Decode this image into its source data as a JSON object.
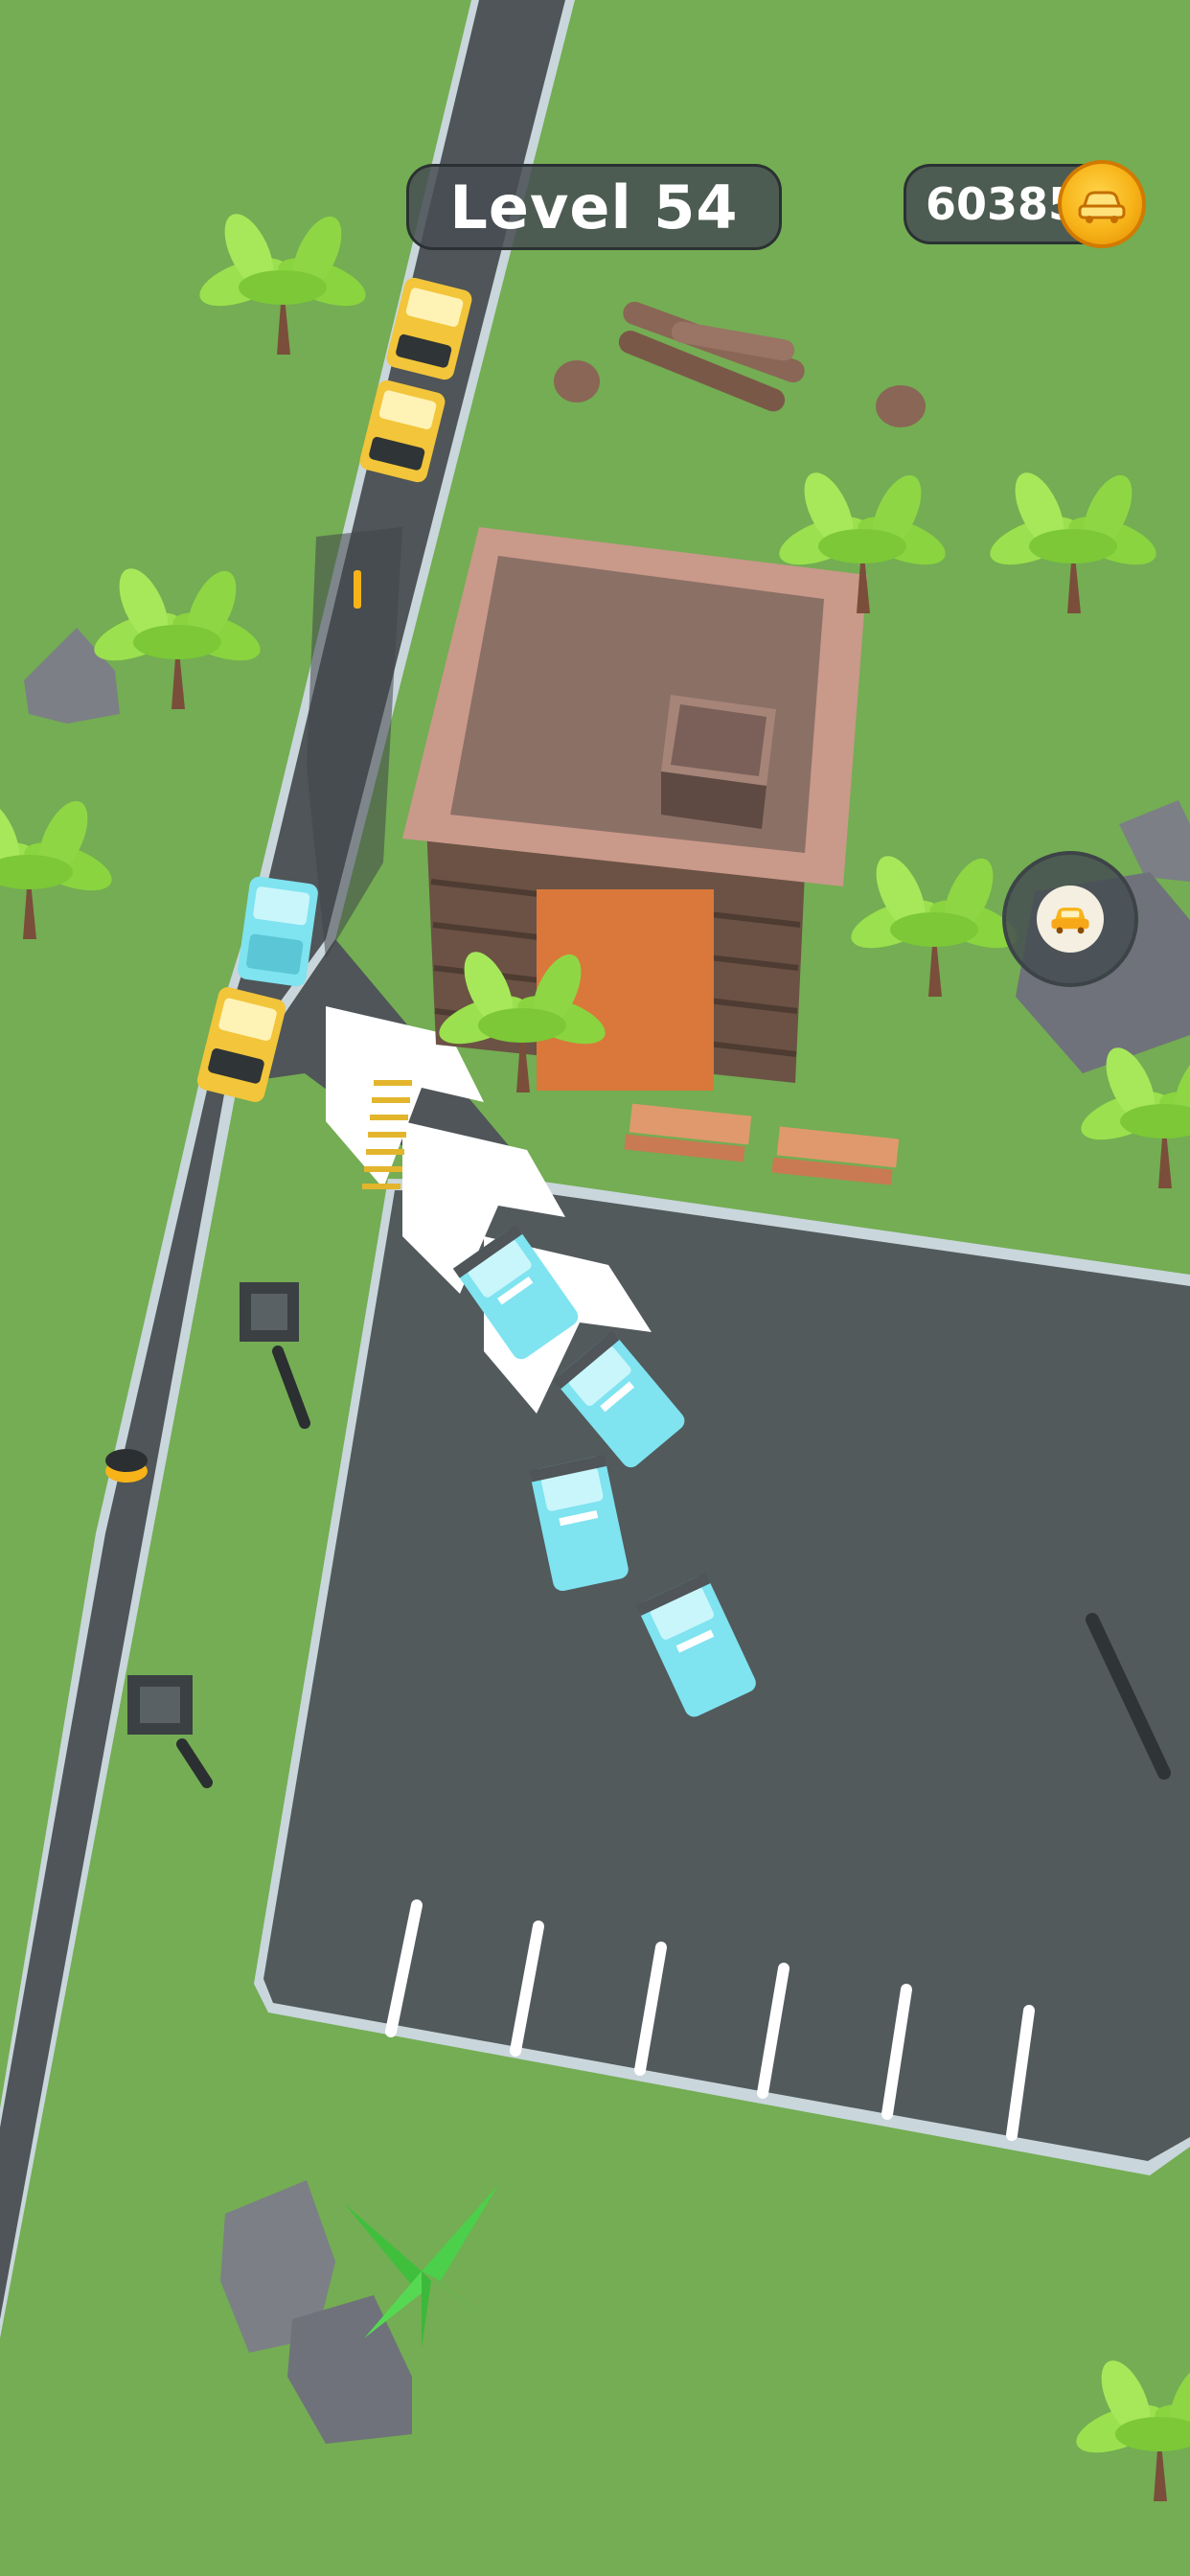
{
  "hud": {
    "level_label": "Level 54",
    "coins": "60385",
    "coin_icon": "coin-car-icon",
    "car_shop_icon": "car-icon"
  },
  "colors": {
    "grass": "#74ad53",
    "road": "#4f5558",
    "curb": "#c9d6dc",
    "taxi": "#f2c53a",
    "cyan_car": "#7fe3f0",
    "building_roof": "#c9998a",
    "building_wall": "#7a5e4e",
    "dropoff_zone": "#d9783a",
    "coin": "#f7b318"
  }
}
